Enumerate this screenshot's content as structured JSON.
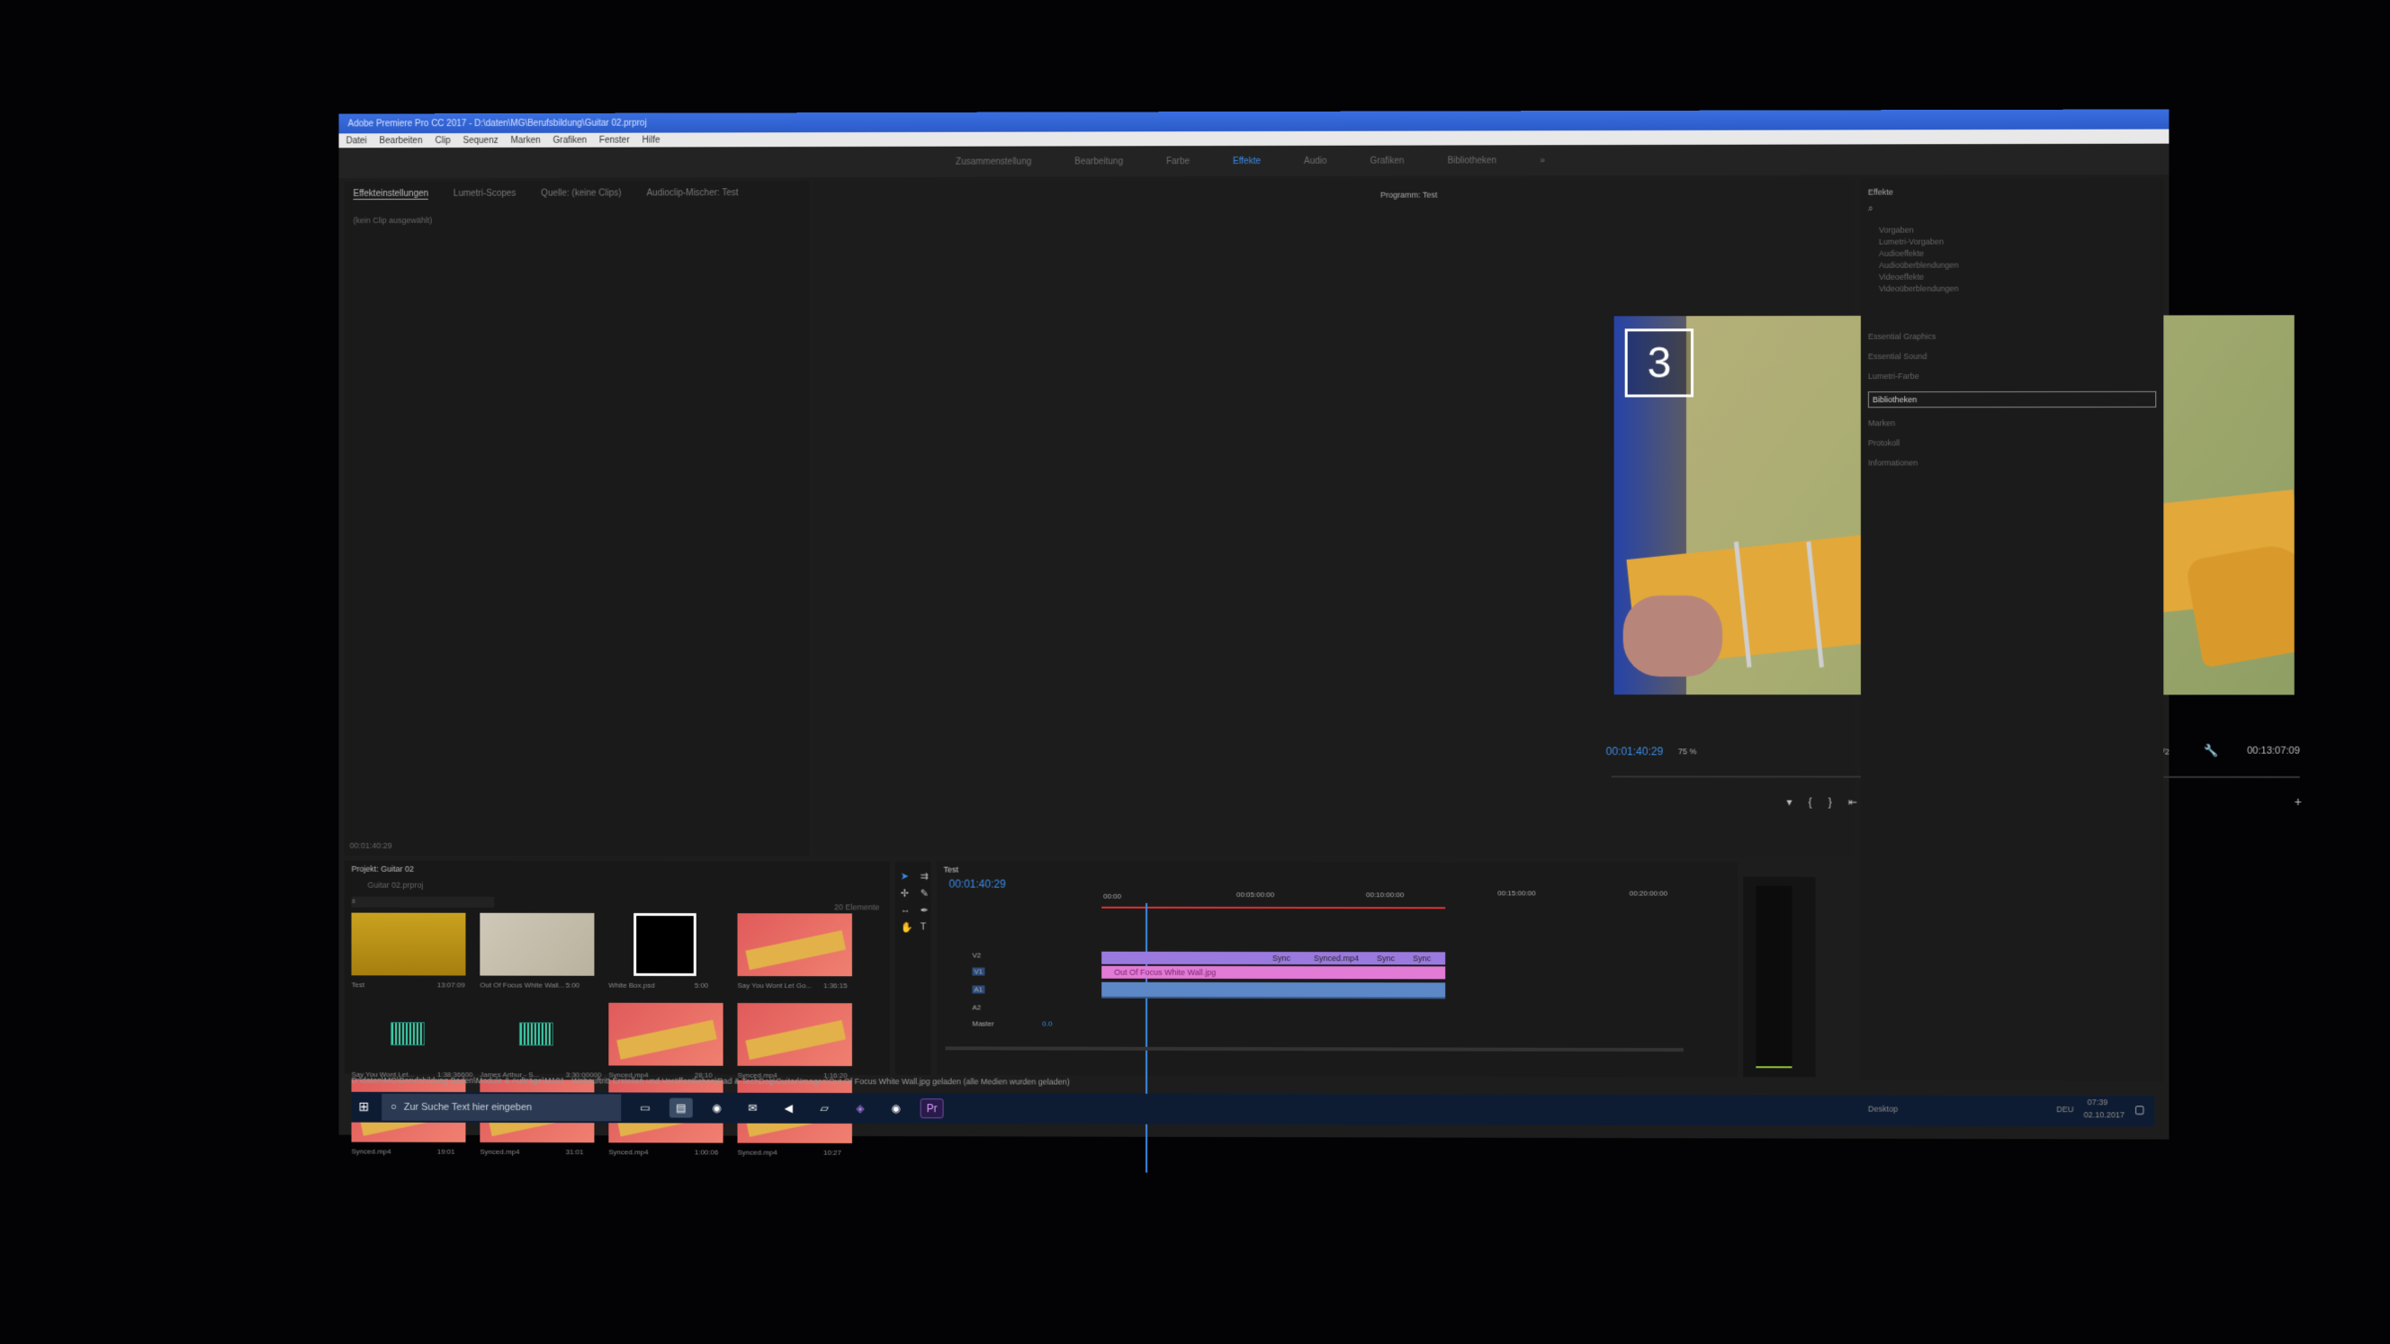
{
  "window": {
    "title": "Adobe Premiere Pro CC 2017 - D:\\daten\\MG\\Berufsbildung\\Guitar 02.prproj",
    "menu": [
      "Datei",
      "Bearbeiten",
      "Clip",
      "Sequenz",
      "Marken",
      "Grafiken",
      "Fenster",
      "Hilfe"
    ]
  },
  "workspaces": {
    "items": [
      "Zusammenstellung",
      "Bearbeitung",
      "Farbe",
      "Effekte",
      "Audio",
      "Grafiken",
      "Bibliotheken"
    ],
    "active": "Effekte",
    "more": "»"
  },
  "source_panel": {
    "tabs": [
      "Effekteinstellungen",
      "Lumetri-Scopes",
      "Quelle: (keine Clips)",
      "Audioclip-Mischer: Test"
    ],
    "empty_text": "(kein Clip ausgewählt)",
    "timecode": "00:01:40:29"
  },
  "program": {
    "title": "Programm: Test",
    "badge": "3",
    "timecode": "00:01:40:29",
    "zoom": "75 %",
    "resolution": "1/2",
    "duration": "00:13:07:09"
  },
  "effects_panel": {
    "title": "Effekte",
    "tree": [
      "Vorgaben",
      "Lumetri-Vorgaben",
      "Audioeffekte",
      "Audioüberblendungen",
      "Videoeffekte",
      "Videoüberblendungen"
    ],
    "sections": [
      "Essential Graphics",
      "Essential Sound",
      "Lumetri-Farbe",
      "Bibliotheken",
      "Marken",
      "Protokoll",
      "Informationen"
    ],
    "selected_section": "Bibliotheken"
  },
  "project": {
    "title": "Projekt: Guitar 02",
    "file": "Guitar 02.prproj",
    "count": "20 Elemente",
    "items": [
      {
        "name": "Test",
        "duration": "13:07:09",
        "kind": "seq"
      },
      {
        "name": "Out Of Focus White Wall...",
        "duration": "5:00",
        "kind": "wall"
      },
      {
        "name": "White Box.psd",
        "duration": "5:00",
        "kind": "box"
      },
      {
        "name": "Say You Wont Let Go...",
        "duration": "1:36:15",
        "kind": "guitar"
      },
      {
        "name": "Say You Wont Let...",
        "duration": "1:38:36600",
        "kind": "audio"
      },
      {
        "name": "James Arthur - S...",
        "duration": "3:30:00000",
        "kind": "audio"
      },
      {
        "name": "Synced.mp4",
        "duration": "28:10",
        "kind": "guitar"
      },
      {
        "name": "Synced.mp4",
        "duration": "1:16:20",
        "kind": "guitar"
      },
      {
        "name": "Synced.mp4",
        "duration": "19:01",
        "kind": "guitar"
      },
      {
        "name": "Synced.mp4",
        "duration": "31:01",
        "kind": "guitar"
      },
      {
        "name": "Synced.mp4",
        "duration": "1:00:06",
        "kind": "guitar"
      },
      {
        "name": "Synced.mp4",
        "duration": "10:27",
        "kind": "guitar"
      }
    ]
  },
  "timeline": {
    "tab": "Test",
    "timecode": "00:01:40:29",
    "ruler": [
      "00:00",
      "00:05:00:00",
      "00:10:00:00",
      "00:15:00:00",
      "00:20:00:00"
    ],
    "tracks": [
      "V2",
      "V1",
      "A1",
      "A2",
      "Master"
    ],
    "master_value": "0.0",
    "clip_label_pink": "Out Of Focus White Wall.jpg",
    "clip_labels_violet": [
      "Sync",
      "Synced.mp4",
      "Sync",
      "Sync"
    ]
  },
  "status": {
    "text": "D:\\daten\\MG\\Berufsbildung Baden\\Module & Aufträge\\M101 - Webauftritt Erstellen und Veröffentlichen\\Rad & TechDog\\Guitar\\Images\\Out Of Focus White Wall.jpg geladen (alle Medien wurden geladen)"
  },
  "taskbar": {
    "search_placeholder": "Zur Suche Text hier eingeben",
    "desktop": "Desktop",
    "lang": "DEU",
    "time": "07:39",
    "date": "02.10.2017"
  },
  "colors": {
    "accent": "#3d8ce8",
    "clip_pink": "#e27bd6",
    "clip_violet": "#9b7ae0",
    "audio": "#5d88c7",
    "titlebar": "#2c5bc8"
  }
}
